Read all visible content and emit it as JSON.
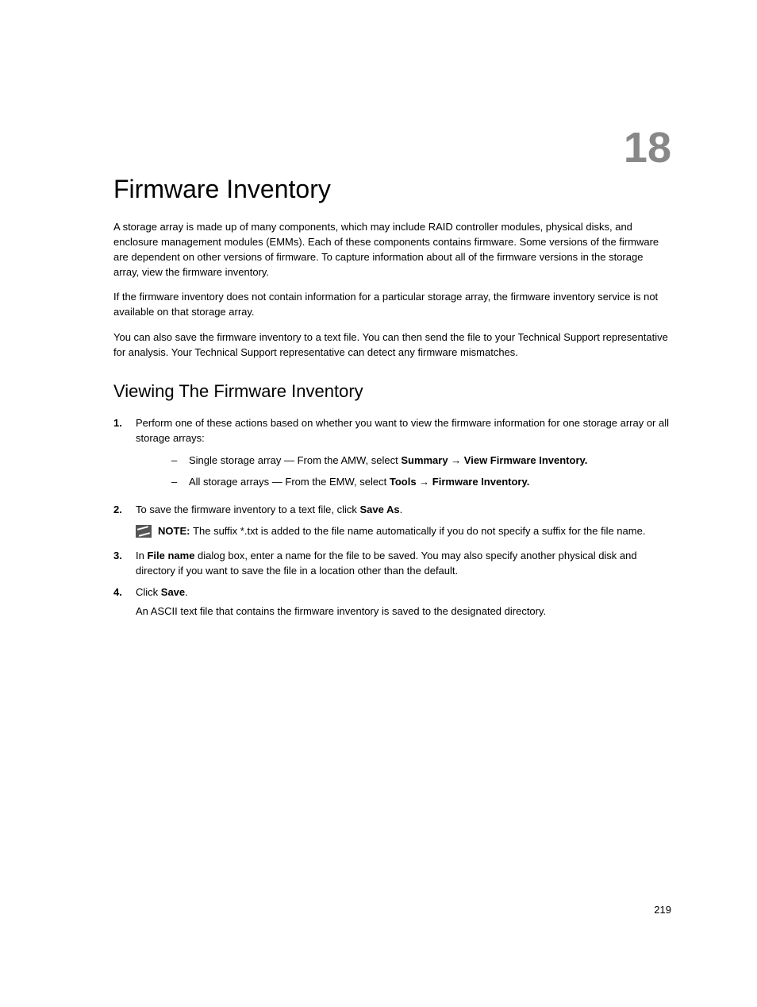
{
  "chapter": {
    "number": "18",
    "title": "Firmware Inventory"
  },
  "paragraphs": {
    "p1": "A storage array is made up of many components, which may include RAID controller modules, physical disks, and enclosure management modules (EMMs). Each of these components contains firmware. Some versions of the firmware are dependent on other versions of firmware. To capture information about all of the firmware versions in the storage array, view the firmware inventory.",
    "p2": "If the firmware inventory does not contain information for a particular storage array, the firmware inventory service is not available on that storage array.",
    "p3": "You can also save the firmware inventory to a text file. You can then send the file to your Technical Support representative for analysis. Your Technical Support representative can detect any firmware mismatches."
  },
  "section": {
    "title": "Viewing The Firmware Inventory"
  },
  "steps": {
    "s1": {
      "num": "1.",
      "intro": "Perform one of these actions based on whether you want to view the firmware information for one storage array or all storage arrays:",
      "sub1": {
        "dash": "–",
        "prefix": "Single storage array — From the AMW, select ",
        "bold": "Summary → View Firmware Inventory."
      },
      "sub2": {
        "dash": "–",
        "prefix": "All storage arrays — From the EMW, select ",
        "bold": "Tools → Firmware Inventory."
      }
    },
    "s2": {
      "num": "2.",
      "prefix": "To save the firmware inventory to a text file, click ",
      "bold": "Save As",
      "suffix": ".",
      "note_label": "NOTE: ",
      "note_text": "The suffix *.txt is added to the file name automatically if you do not specify a suffix for the file name."
    },
    "s3": {
      "num": "3.",
      "prefix": "In ",
      "bold": "File name",
      "suffix": " dialog box, enter a name for the file to be saved. You may also specify another physical disk and directory if you want to save the file in a location other than the default."
    },
    "s4": {
      "num": "4.",
      "prefix": "Click ",
      "bold": "Save",
      "suffix": ".",
      "tail": "An ASCII text file that contains the firmware inventory is saved to the designated directory."
    }
  },
  "page_number": "219"
}
